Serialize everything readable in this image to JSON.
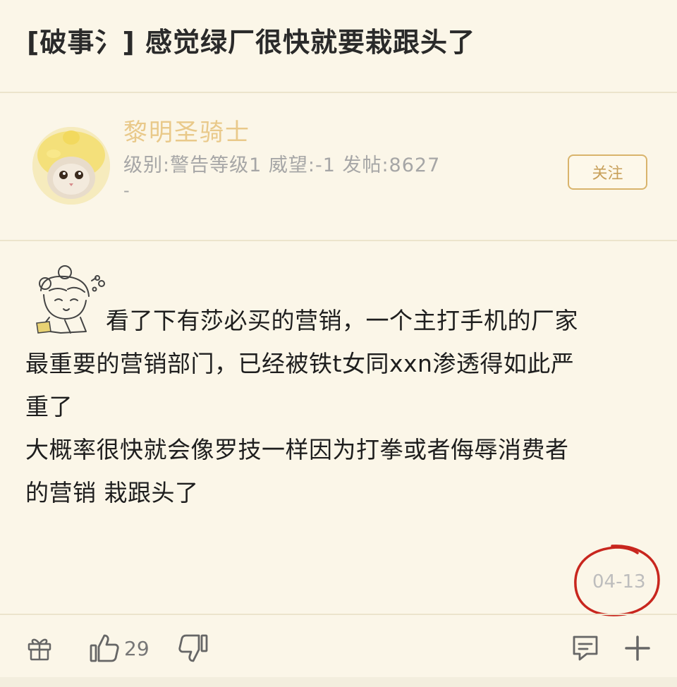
{
  "post": {
    "title": "[破事氵] 感觉绿厂很快就要栽跟头了"
  },
  "author": {
    "username": "黎明圣骑士",
    "meta": "级别:警告等级1 威望:-1 发帖:8627",
    "meta_extra": "-",
    "follow_label": "关注"
  },
  "content": {
    "lines": [
      "看了下有莎必买的营销，一个主打手机的厂家",
      "最重要的营销部门，已经被铁t女同xxn渗透得如此严",
      "重了",
      "大概率很快就会像罗技一样因为打拳或者侮辱消费者",
      "的营销 栽跟头了"
    ]
  },
  "footer": {
    "date": "04-13",
    "like_count": "29"
  },
  "colors": {
    "background": "#fbf6e8",
    "username": "#e9c98a",
    "follow_border": "#d9b46c",
    "annotation_circle": "#c8261e"
  },
  "icons": [
    "gift-icon",
    "thumbs-up-icon",
    "thumbs-down-icon",
    "comment-icon",
    "plus-icon"
  ]
}
